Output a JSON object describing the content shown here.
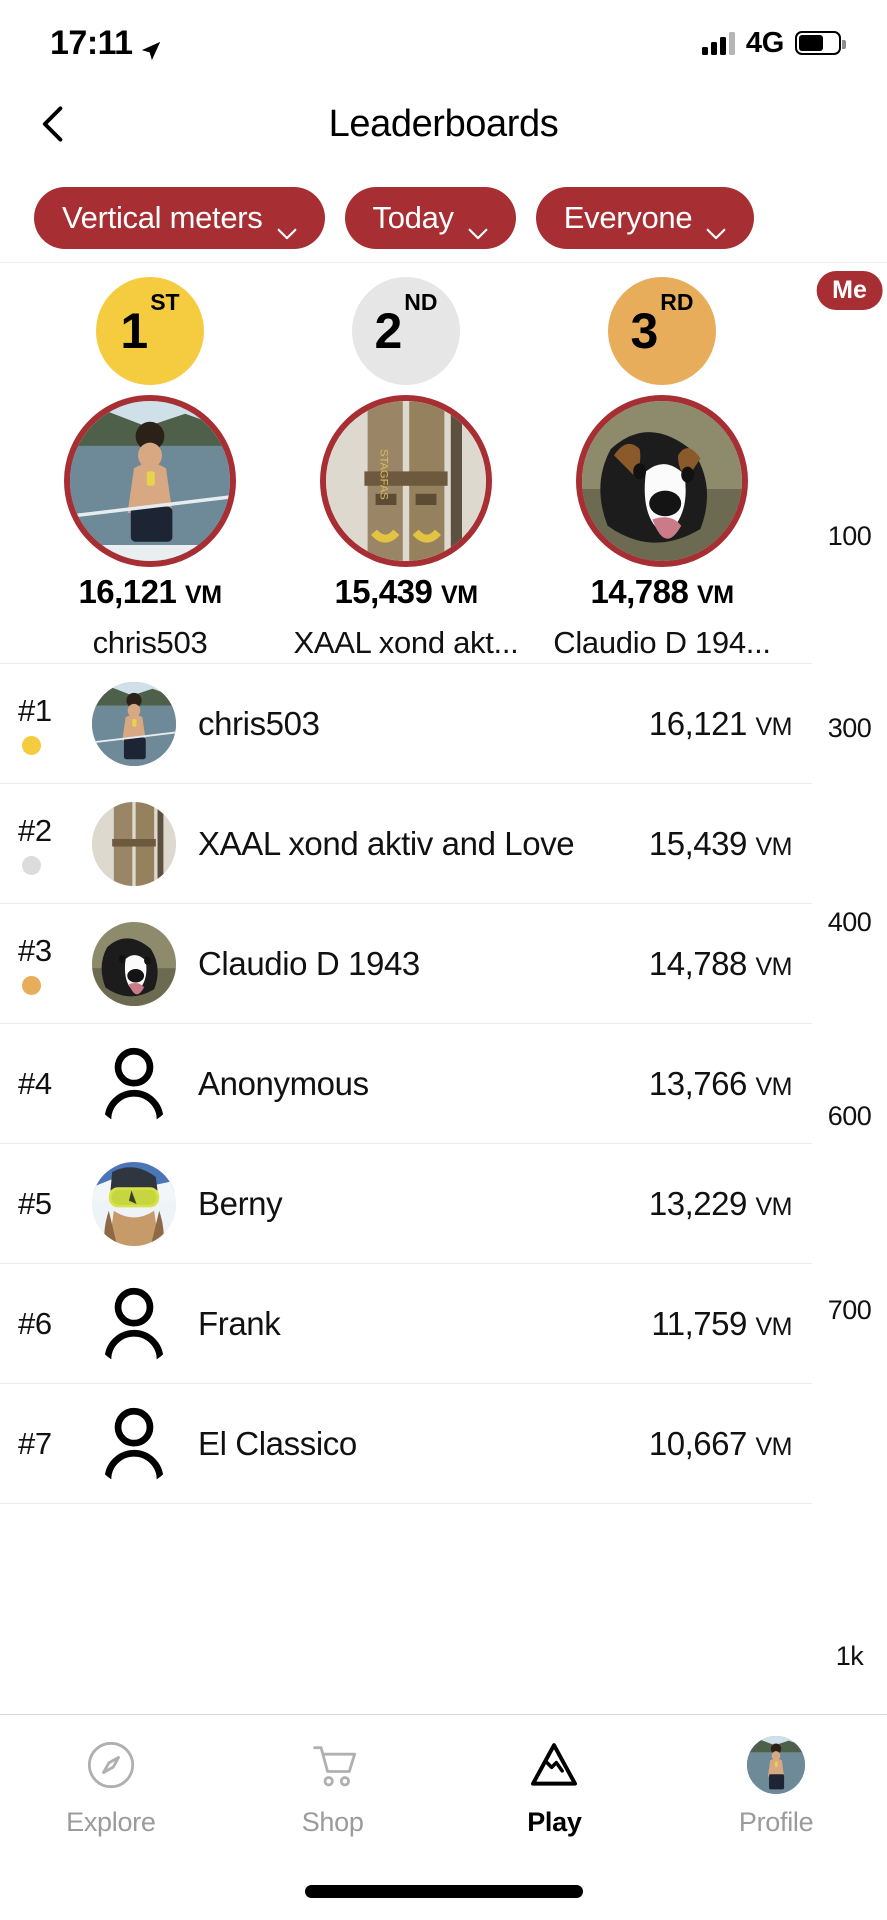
{
  "status_bar": {
    "time": "17:11",
    "location_icon": "location-arrow-icon",
    "signal_icon": "cellular-bars-icon",
    "network": "4G",
    "battery_icon": "battery-icon"
  },
  "header": {
    "back_icon": "chevron-left-icon",
    "title": "Leaderboards"
  },
  "filters": [
    {
      "label": "Vertical meters",
      "icon": "chevron-down-icon"
    },
    {
      "label": "Today",
      "icon": "chevron-down-icon"
    },
    {
      "label": "Everyone",
      "icon": "chevron-down-icon"
    }
  ],
  "podium": [
    {
      "place": "1",
      "ordinal": "ST",
      "medal_color": "#f5cb3f",
      "score": "16,121",
      "unit": "VM",
      "name": "chris503",
      "avatar": "photo-man-on-boat"
    },
    {
      "place": "2",
      "ordinal": "ND",
      "medal_color": "#e6e6e6",
      "score": "15,439",
      "unit": "VM",
      "name": "XAAL xond akt...",
      "avatar": "photo-wooden-skis"
    },
    {
      "place": "3",
      "ordinal": "RD",
      "medal_color": "#e8ad5a",
      "score": "14,788",
      "unit": "VM",
      "name": "Claudio D 194...",
      "avatar": "photo-dog"
    }
  ],
  "list": {
    "rows": [
      {
        "rank": "#1",
        "dot_color": "#f5cb3f",
        "name": "chris503",
        "score": "16,121",
        "unit": "VM",
        "avatar": "photo-man-on-boat"
      },
      {
        "rank": "#2",
        "dot_color": "#dcdcdc",
        "name": "XAAL xond aktiv and Love",
        "score": "15,439",
        "unit": "VM",
        "avatar": "photo-wooden-skis"
      },
      {
        "rank": "#3",
        "dot_color": "#e8ad5a",
        "name": "Claudio D 1943",
        "score": "14,788",
        "unit": "VM",
        "avatar": "photo-dog"
      },
      {
        "rank": "#4",
        "dot_color": "",
        "name": "Anonymous",
        "score": "13,766",
        "unit": "VM",
        "avatar": "person-placeholder-icon"
      },
      {
        "rank": "#5",
        "dot_color": "",
        "name": "Berny",
        "score": "13,229",
        "unit": "VM",
        "avatar": "photo-skier-goggles"
      },
      {
        "rank": "#6",
        "dot_color": "",
        "name": "Frank",
        "score": "11,759",
        "unit": "VM",
        "avatar": "person-placeholder-icon"
      },
      {
        "rank": "#7",
        "dot_color": "",
        "name": "El Classico",
        "score": "10,667",
        "unit": "VM",
        "avatar": "person-placeholder-icon"
      }
    ]
  },
  "scroll_rail": {
    "me_label": "Me",
    "labels": [
      "100",
      "300",
      "400",
      "600",
      "700",
      "1k"
    ]
  },
  "tabbar": {
    "items": [
      {
        "label": "Explore",
        "icon": "compass-icon",
        "active": false
      },
      {
        "label": "Shop",
        "icon": "shopping-cart-icon",
        "active": false
      },
      {
        "label": "Play",
        "icon": "mountain-icon",
        "active": true
      },
      {
        "label": "Profile",
        "icon": "avatar-icon",
        "active": false
      }
    ]
  },
  "colors": {
    "brand_red": "#a72f33",
    "gold": "#f5cb3f",
    "silver": "#dcdcdc",
    "bronze": "#e8ad5a"
  }
}
